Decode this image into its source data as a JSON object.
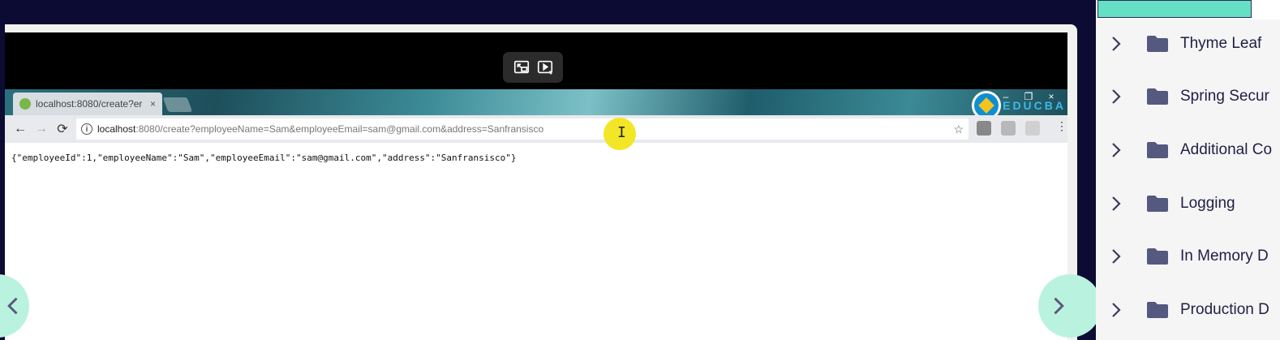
{
  "video": {
    "pip_exit_icon": "exit-fullscreen-icon",
    "pip_ai_icon": "smart-video-icon"
  },
  "browser": {
    "tab_title": "localhost:8080/create?er",
    "tab_close": "×",
    "window_min": "–",
    "window_restore": "❐",
    "window_close": "×",
    "brand": "EDUCBA",
    "url_host": "localhost",
    "url_rest": ":8080/create?employeeName=Sam&employeeEmail=sam@gmail.com&address=Sanfransisco",
    "back": "←",
    "forward": "→",
    "reload": "⟳",
    "star": "☆",
    "menu": "⋮",
    "json_response": "{\"employeeId\":1,\"employeeName\":\"Sam\",\"employeeEmail\":\"sam@gmail.com\",\"address\":\"Sanfransisco\"}"
  },
  "sidebar": {
    "accent": "#66e0c4",
    "items": [
      {
        "label": "Thyme Leaf"
      },
      {
        "label": "Spring Secur"
      },
      {
        "label": "Additional Co"
      },
      {
        "label": "Logging"
      },
      {
        "label": "In Memory D"
      },
      {
        "label": "Production D"
      }
    ]
  }
}
